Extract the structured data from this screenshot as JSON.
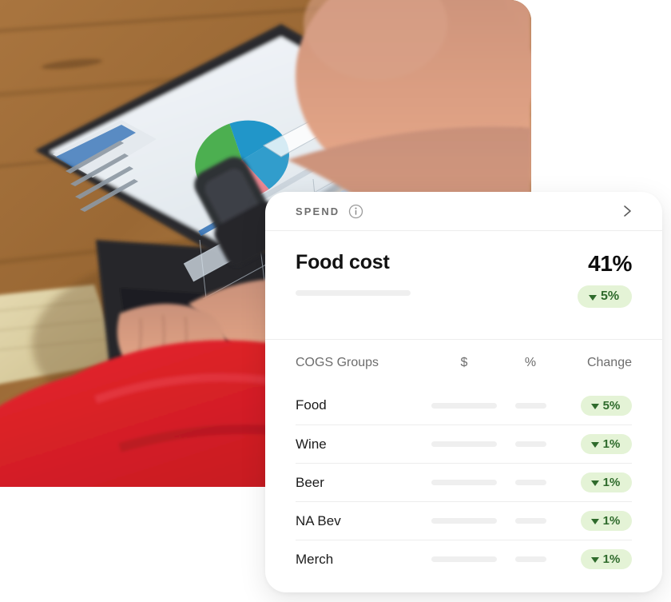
{
  "photo": {
    "alt": "Person in red shirt working at a laptop on a wooden table, screen shows a pie chart report",
    "screen_chart_type": "pie",
    "colors": {
      "table_wood": "#9c6a38",
      "shirt_red": "#e0242c",
      "skin": "#cf9178",
      "laptop_body": "#2b2b2d",
      "screen_bg": "#eef2f6",
      "pie_green": "#4caf50",
      "pie_blue": "#2196c9",
      "pie_pink": "#e8858f"
    }
  },
  "card": {
    "header": {
      "label": "SPEND",
      "info_icon": "info-circle-icon",
      "chevron_icon": "chevron-right-icon"
    },
    "hero": {
      "title": "Food cost",
      "value": "41%",
      "badge": {
        "direction_icon": "triangle-down-icon",
        "text": "5%"
      }
    },
    "table": {
      "headers": {
        "name": "COGS Groups",
        "dollar": "$",
        "percent": "%",
        "change": "Change"
      },
      "rows": [
        {
          "name": "Food",
          "dollar": "",
          "percent": "",
          "change": "5%",
          "direction_icon": "triangle-down-icon"
        },
        {
          "name": "Wine",
          "dollar": "",
          "percent": "",
          "change": "1%",
          "direction_icon": "triangle-down-icon"
        },
        {
          "name": "Beer",
          "dollar": "",
          "percent": "",
          "change": "1%",
          "direction_icon": "triangle-down-icon"
        },
        {
          "name": "NA Bev",
          "dollar": "",
          "percent": "",
          "change": "1%",
          "direction_icon": "triangle-down-icon"
        },
        {
          "name": "Merch",
          "dollar": "",
          "percent": "",
          "change": "1%",
          "direction_icon": "triangle-down-icon"
        }
      ]
    },
    "colors": {
      "badge_background": "#e4f3d6",
      "badge_text": "#2f6b2c",
      "divider": "#ededed",
      "placeholder_bar": "#efefef",
      "muted_text": "#6d6d6d",
      "card_background": "#ffffff"
    }
  }
}
